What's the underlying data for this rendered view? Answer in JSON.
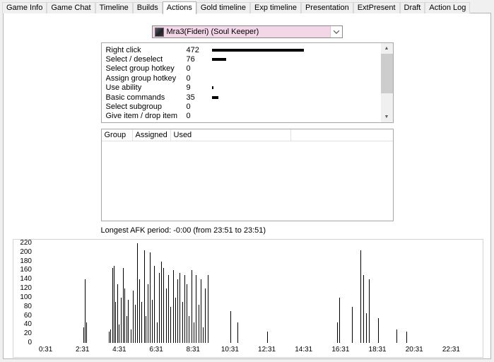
{
  "tabs": [
    "Game Info",
    "Game Chat",
    "Timeline",
    "Builds",
    "Actions",
    "Gold timeline",
    "Exp timeline",
    "Presentation",
    "ExtPresent",
    "Draft",
    "Action Log"
  ],
  "active_tab": "Actions",
  "player_dropdown": {
    "value": "Mra3(Fideri) (Soul Keeper)",
    "icon": "hero-portrait-icon"
  },
  "actions_list": {
    "bar_scale_max": 472,
    "rows": [
      {
        "label": "Right click",
        "count": 472
      },
      {
        "label": "Select / deselect",
        "count": 76
      },
      {
        "label": "Select group hotkey",
        "count": 0
      },
      {
        "label": "Assign group hotkey",
        "count": 0
      },
      {
        "label": "Use ability",
        "count": 9
      },
      {
        "label": "Basic commands",
        "count": 35
      },
      {
        "label": "Select subgroup",
        "count": 0
      },
      {
        "label": "Give item / drop item",
        "count": 0
      }
    ]
  },
  "groups_table": {
    "columns": [
      "Group",
      "Assigned",
      "Used"
    ],
    "rows": []
  },
  "afk_text": "Longest AFK period: -0:00 (from 23:51 to 23:51)",
  "chart_data": {
    "type": "bar",
    "title": "Actions per minute over game time",
    "xlabel": "",
    "ylabel": "",
    "ylim": [
      0,
      220
    ],
    "y_ticks": [
      0,
      20,
      40,
      60,
      80,
      100,
      120,
      140,
      160,
      180,
      200,
      220
    ],
    "x_range_minutes": [
      0,
      24
    ],
    "x_ticks": [
      {
        "label": "0:31",
        "minutes": 0.52
      },
      {
        "label": "2:31",
        "minutes": 2.52
      },
      {
        "label": "4:31",
        "minutes": 4.52
      },
      {
        "label": "6:31",
        "minutes": 6.52
      },
      {
        "label": "8:31",
        "minutes": 8.52
      },
      {
        "label": "10:31",
        "minutes": 10.52
      },
      {
        "label": "12:31",
        "minutes": 12.52
      },
      {
        "label": "14:31",
        "minutes": 14.52
      },
      {
        "label": "16:31",
        "minutes": 16.52
      },
      {
        "label": "18:31",
        "minutes": 18.52
      },
      {
        "label": "20:31",
        "minutes": 20.52
      },
      {
        "label": "22:31",
        "minutes": 22.52
      }
    ],
    "bars": [
      [
        2.55,
        35
      ],
      [
        2.63,
        140
      ],
      [
        2.73,
        45
      ],
      [
        3.93,
        25
      ],
      [
        4.03,
        30
      ],
      [
        4.13,
        165
      ],
      [
        4.22,
        170
      ],
      [
        4.31,
        90
      ],
      [
        4.4,
        130
      ],
      [
        4.5,
        40
      ],
      [
        4.6,
        100
      ],
      [
        4.7,
        165
      ],
      [
        4.8,
        120
      ],
      [
        4.9,
        60
      ],
      [
        5.0,
        95
      ],
      [
        5.12,
        30
      ],
      [
        5.25,
        115
      ],
      [
        5.38,
        85
      ],
      [
        5.5,
        220
      ],
      [
        5.6,
        140
      ],
      [
        5.72,
        90
      ],
      [
        5.85,
        205
      ],
      [
        5.95,
        60
      ],
      [
        6.05,
        130
      ],
      [
        6.18,
        200
      ],
      [
        6.3,
        95
      ],
      [
        6.42,
        170
      ],
      [
        6.55,
        45
      ],
      [
        6.67,
        155
      ],
      [
        6.8,
        180
      ],
      [
        6.92,
        165
      ],
      [
        7.05,
        120
      ],
      [
        7.18,
        150
      ],
      [
        7.3,
        80
      ],
      [
        7.42,
        160
      ],
      [
        7.55,
        100
      ],
      [
        7.68,
        140
      ],
      [
        7.8,
        155
      ],
      [
        7.92,
        90
      ],
      [
        8.05,
        150
      ],
      [
        8.18,
        130
      ],
      [
        8.3,
        60
      ],
      [
        8.42,
        160
      ],
      [
        8.55,
        45
      ],
      [
        8.68,
        150
      ],
      [
        8.8,
        85
      ],
      [
        8.92,
        140
      ],
      [
        9.05,
        35
      ],
      [
        9.18,
        120
      ],
      [
        9.3,
        150
      ],
      [
        10.55,
        70
      ],
      [
        10.92,
        45
      ],
      [
        12.55,
        25
      ],
      [
        16.35,
        45
      ],
      [
        16.45,
        100
      ],
      [
        17.15,
        80
      ],
      [
        17.6,
        205
      ],
      [
        17.75,
        150
      ],
      [
        17.9,
        65
      ],
      [
        18.05,
        140
      ],
      [
        18.55,
        55
      ],
      [
        19.55,
        30
      ],
      [
        20.1,
        25
      ]
    ]
  }
}
